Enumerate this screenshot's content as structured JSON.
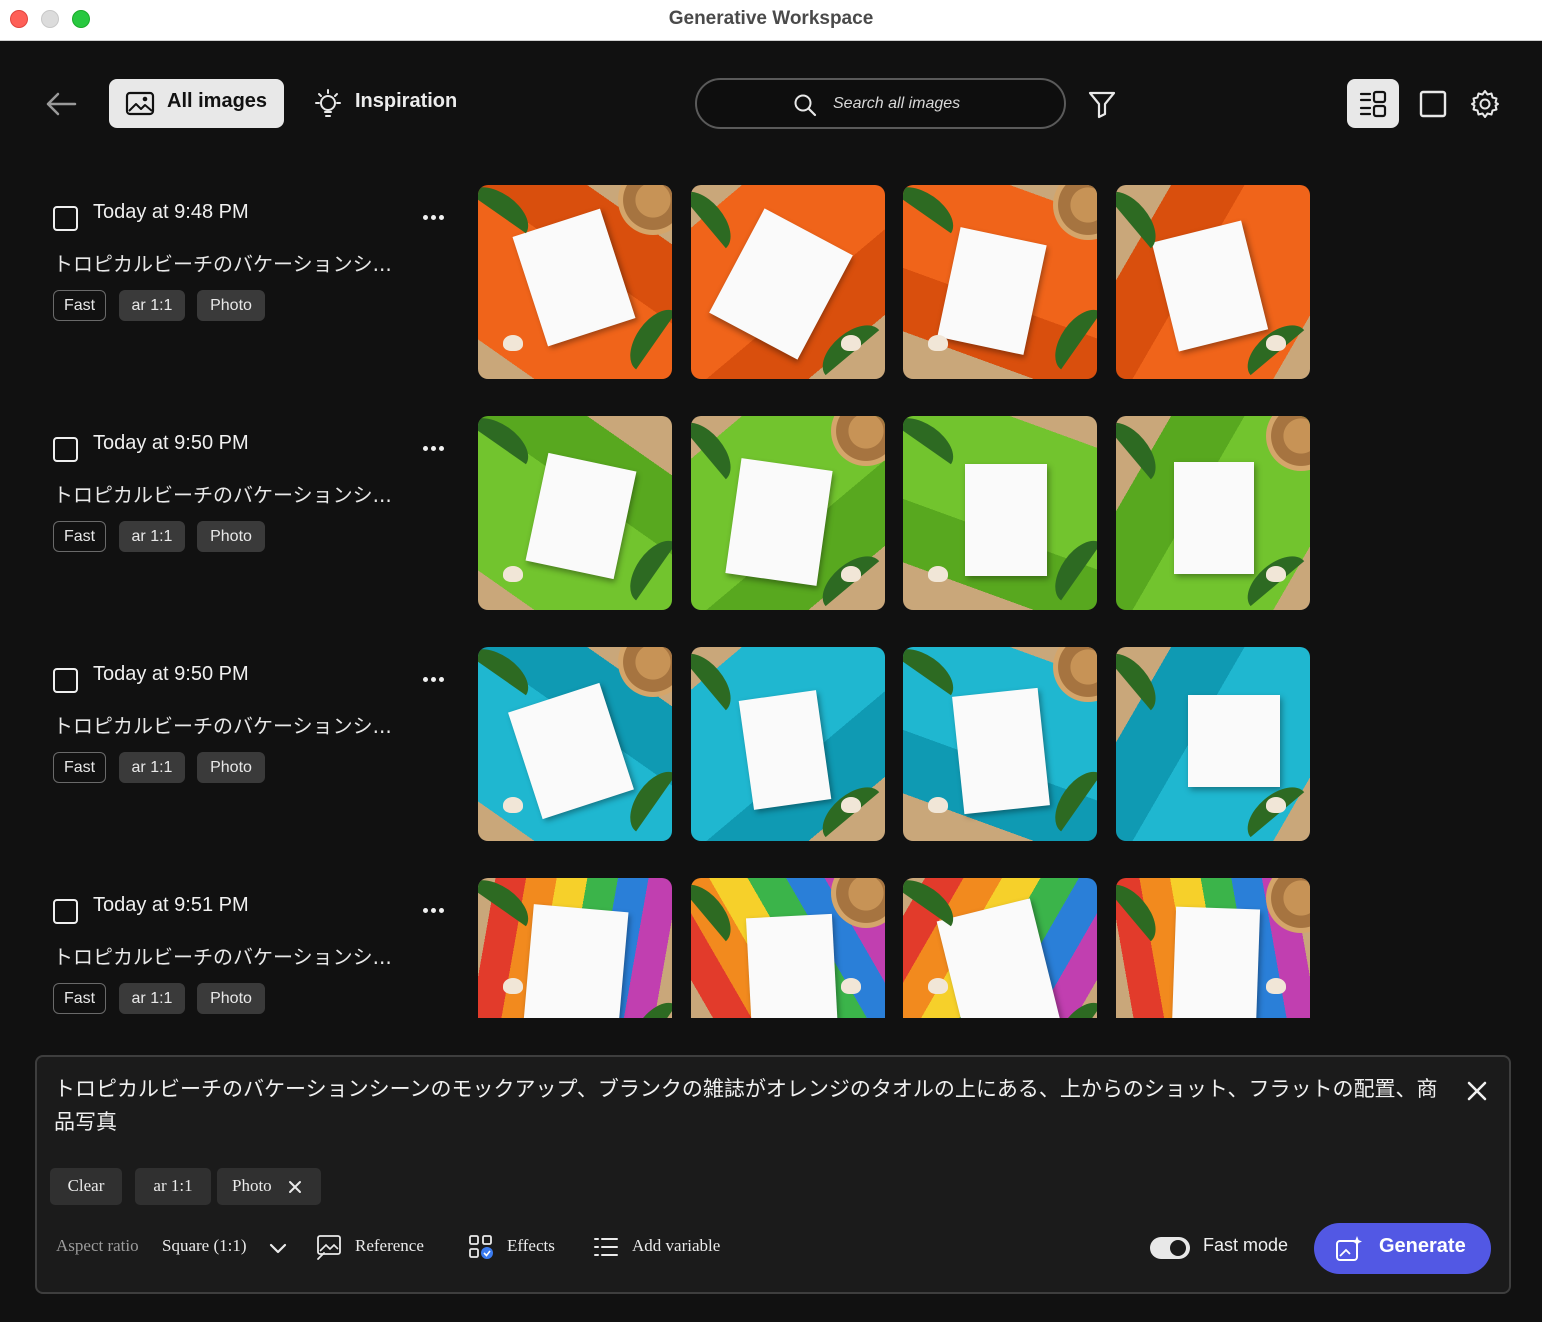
{
  "window": {
    "title": "Generative Workspace"
  },
  "toolbar": {
    "tabs": [
      {
        "label": "All images",
        "icon": "image-icon",
        "active": true
      },
      {
        "label": "Inspiration",
        "icon": "lightbulb-icon",
        "active": false
      }
    ],
    "search_placeholder": "Search all images"
  },
  "groups": [
    {
      "timestamp": "Today at 9:48 PM",
      "prompt": "トロピカルビーチのバケーションシ...",
      "tags": [
        "Fast",
        "ar 1:1",
        "Photo"
      ],
      "towel_color": "#f0641a",
      "towel_shade": "#d94f0d"
    },
    {
      "timestamp": "Today at 9:50 PM",
      "prompt": "トロピカルビーチのバケーションシ...",
      "tags": [
        "Fast",
        "ar 1:1",
        "Photo"
      ],
      "towel_color": "#72c42e",
      "towel_shade": "#58a81f"
    },
    {
      "timestamp": "Today at 9:50 PM",
      "prompt": "トロピカルビーチのバケーションシ...",
      "tags": [
        "Fast",
        "ar 1:1",
        "Photo"
      ],
      "towel_color": "#1fb7d0",
      "towel_shade": "#0f9ab3"
    },
    {
      "timestamp": "Today at 9:51 PM",
      "prompt": "トロピカルビーチのバケーションシ...",
      "tags": [
        "Fast",
        "ar 1:1",
        "Photo"
      ],
      "towel_color": "rainbow",
      "towel_shade": "#e23b2b"
    }
  ],
  "composer": {
    "prompt": "トロピカルビーチのバケーションシーンのモックアップ、ブランクの雑誌がオレンジのタオルの上にある、上からのショット、フラットの配置、商品写真",
    "chips": {
      "clear": "Clear",
      "aspect": "ar 1:1",
      "style": "Photo"
    },
    "aspect_label": "Aspect ratio",
    "aspect_value": "Square (1:1)",
    "reference": "Reference",
    "effects": "Effects",
    "add_variable": "Add variable",
    "fast_mode_label": "Fast mode",
    "fast_mode_on": true,
    "generate": "Generate"
  },
  "colors": {
    "accent": "#5258e4",
    "background": "#111111",
    "sand": "#c9a77a"
  }
}
